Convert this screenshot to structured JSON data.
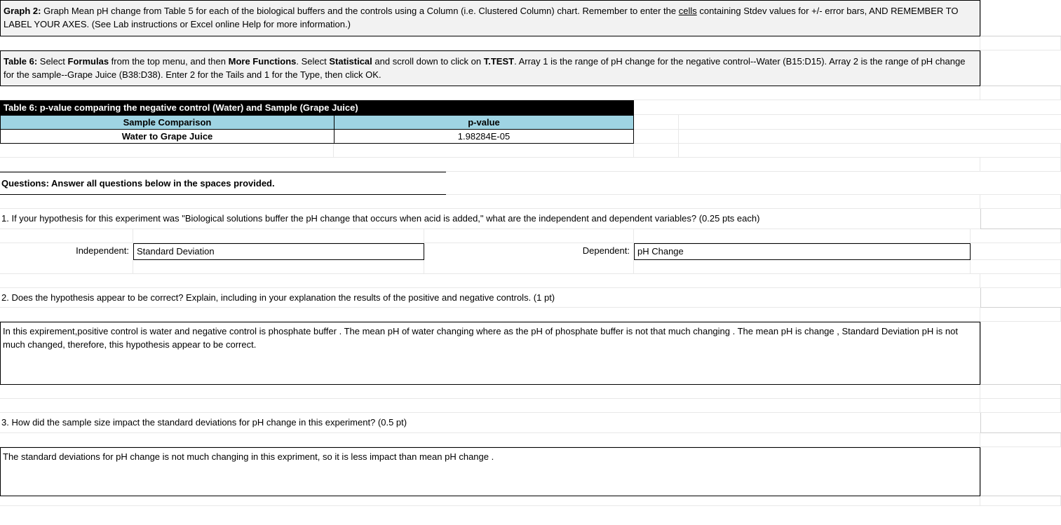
{
  "graph2": {
    "label": "Graph 2:",
    "text_part1": " Graph Mean pH change from Table 5 for each of the biological buffers and the controls using a Column (i.e. Clustered Column) chart. Remember to enter the ",
    "cells_word": "cells",
    "text_part2": " containing Stdev values for +/- error bars, AND REMEMBER TO LABEL YOUR AXES. (See Lab instructions or Excel online Help for more information.)"
  },
  "table6_instr": {
    "label": "Table 6:",
    "t1": " Select ",
    "b1": "Formulas",
    "t2": " from the top menu, and then ",
    "b2": "More Functions",
    "t3": ". Select ",
    "b3": "Statistical",
    "t4": " and scroll down to click on ",
    "b4": "T.TEST",
    "t5": ". Array 1 is the range of pH change for the negative control--Water (B15:D15). Array 2 is the range of pH change for the sample--Grape Juice (B38:D38). Enter 2 for the Tails and 1 for the Type, then click OK."
  },
  "table6": {
    "title": "Table 6: p-value comparing the negative control (Water) and Sample (Grape Juice)",
    "header_left": "Sample Comparison",
    "header_right": "p-value",
    "data_left": "Water to Grape Juice",
    "data_right": "1.98284E-05"
  },
  "questions_heading": "Questions: Answer all questions below in the spaces provided.",
  "q1": {
    "text": "1.  If your hypothesis for this experiment was \"Biological solutions buffer the pH change that occurs when acid is added,\" what are the independent and dependent variables? (0.25 pts each)",
    "independent_label": "Independent:",
    "independent_value": "Standard Deviation",
    "dependent_label": "Dependent:",
    "dependent_value": "pH Change"
  },
  "q2": {
    "text": "2.  Does the hypothesis appear to be correct? Explain, including in your explanation the results of the positive and negative controls. (1 pt)",
    "answer": "In this expirement,positive control is water and negative control is phosphate buffer . The mean pH of water changing where as the pH of  phosphate buffer is not that much changing . The mean pH is change , Standard Deviation pH is  not much changed, therefore, this hypothesis appear to be correct."
  },
  "q3": {
    "text": "3.  How did the sample size impact the standard deviations for pH change in this experiment? (0.5 pt)",
    "answer": "The standard deviations for pH change is not much changing in this expriment,  so it is less impact than mean pH change ."
  }
}
